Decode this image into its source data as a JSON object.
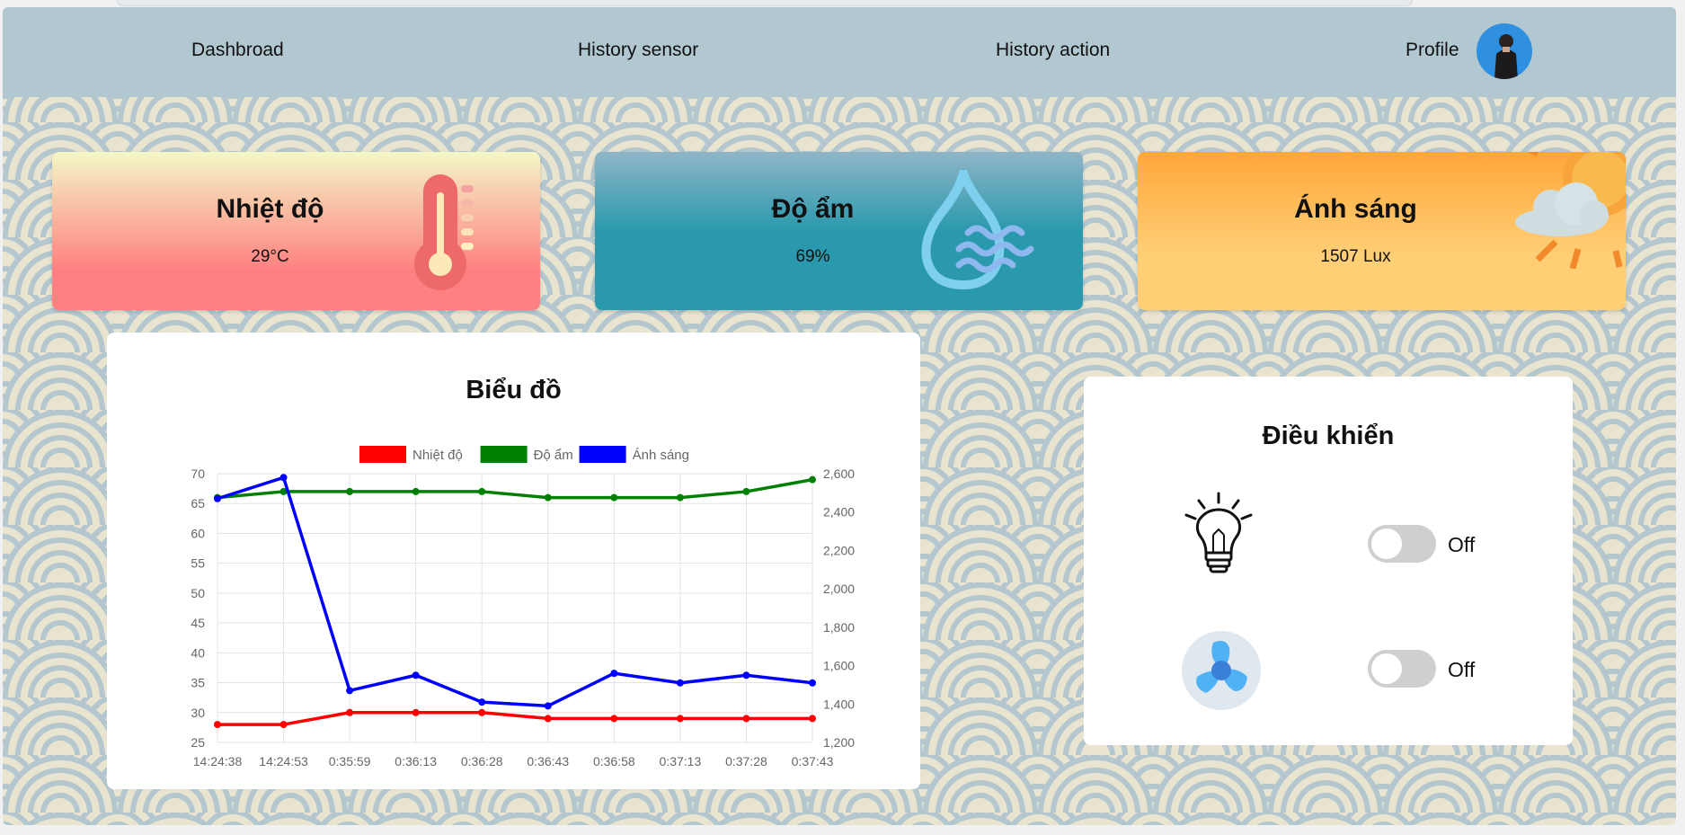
{
  "nav": {
    "dashboard": "Dashbroad",
    "history_sensor": "History sensor",
    "history_action": "History action",
    "profile": "Profile"
  },
  "cards": {
    "temperature": {
      "title": "Nhiệt độ",
      "value": "29°C",
      "icon": "thermometer-icon",
      "gradient": [
        "#f3f7c6",
        "#ff7f7f"
      ]
    },
    "humidity": {
      "title": "Độ ẩm",
      "value": "69%",
      "icon": "water-drop-icon",
      "gradient": [
        "#8fb5c7",
        "#2a99ad"
      ]
    },
    "light": {
      "title": "Ánh sáng",
      "value": "1507 Lux",
      "icon": "sun-cloud-icon",
      "gradient": [
        "#ffa73a",
        "#ffce75"
      ]
    }
  },
  "chart": {
    "title": "Biểu đồ"
  },
  "chart_data": {
    "type": "line",
    "x": [
      "14:24:38",
      "14:24:53",
      "0:35:59",
      "0:36:13",
      "0:36:28",
      "0:36:43",
      "0:36:58",
      "0:37:13",
      "0:37:28",
      "0:37:43"
    ],
    "series": [
      {
        "name": "Nhiệt độ",
        "color": "#ff0000",
        "axis": "left",
        "values": [
          28,
          28,
          30,
          30,
          30,
          29,
          29,
          29,
          29,
          29
        ]
      },
      {
        "name": "Độ ẩm",
        "color": "#008000",
        "axis": "left",
        "values": [
          66,
          67,
          67,
          67,
          67,
          66,
          66,
          66,
          67,
          69
        ]
      },
      {
        "name": "Ánh sáng",
        "color": "#0000ff",
        "axis": "right",
        "values": [
          2470,
          2580,
          1470,
          1550,
          1410,
          1390,
          1560,
          1510,
          1550,
          1510
        ]
      }
    ],
    "y_left": {
      "ticks": [
        "70",
        "65",
        "60",
        "55",
        "50",
        "45",
        "40",
        "35",
        "30",
        "25"
      ],
      "range": [
        25,
        70
      ]
    },
    "y_right": {
      "ticks": [
        "2,600",
        "2,400",
        "2,200",
        "2,000",
        "1,800",
        "1,600",
        "1,400",
        "1,200"
      ],
      "range": [
        1200,
        2600
      ]
    },
    "legend": "top-center",
    "grid": true
  },
  "control": {
    "title": "Điều khiển",
    "devices": [
      {
        "name": "light",
        "icon": "lightbulb-icon",
        "state": "Off"
      },
      {
        "name": "fan",
        "icon": "fan-icon",
        "state": "Off"
      }
    ]
  }
}
